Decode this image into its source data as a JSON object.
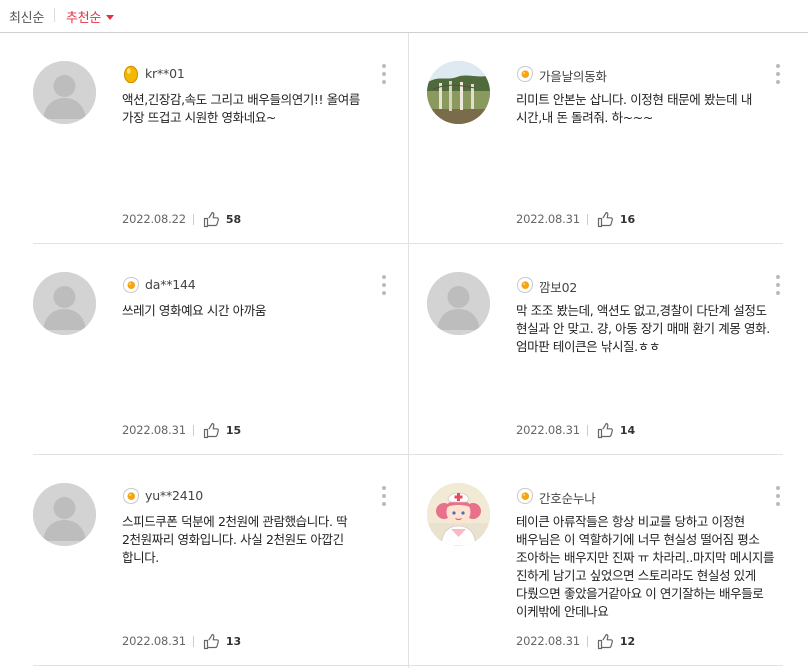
{
  "sort": {
    "latest_label": "최신순",
    "recommended_label": "추천순",
    "active_color": "#e33244"
  },
  "reviews": [
    {
      "username": "kr**01",
      "badge_icon": "gold-egg-icon",
      "avatar": "default-avatar",
      "text": "액션,긴장감,속도 그리고 배우들의연기!! 올여름 가장 뜨겁고 시원한 영화네요~",
      "date": "2022.08.22",
      "likes": "58"
    },
    {
      "username": "가을날의동화",
      "badge_icon": "fried-egg-icon",
      "avatar": "outdoor-photo-avatar",
      "text": "리미트 안본눈 삽니다. 이정현 태문에 봤는데 내 시간,내 돈 돌려줘. 하~~~",
      "date": "2022.08.31",
      "likes": "16"
    },
    {
      "username": "da**144",
      "badge_icon": "fried-egg-icon",
      "avatar": "default-avatar",
      "text": "쓰레기 영화예요 시간 아까움",
      "date": "2022.08.31",
      "likes": "15"
    },
    {
      "username": "깜보02",
      "badge_icon": "fried-egg-icon",
      "avatar": "default-avatar",
      "text": "막 조조 봤는데, 액션도 없고,경찰이 다단계 설정도 현실과 안 맞고. 걍, 아동 장기 매매 환기 계몽 영화. 엄마판 테이큰은 낚시질.ㅎㅎ",
      "date": "2022.08.31",
      "likes": "14"
    },
    {
      "username": "yu**2410",
      "badge_icon": "fried-egg-icon",
      "avatar": "default-avatar",
      "text": "스피드쿠폰 덕분에 2천원에 관람했습니다. 딱 2천원짜리 영화입니다. 사실 2천원도 아깝긴 합니다.",
      "date": "2022.08.31",
      "likes": "13"
    },
    {
      "username": "간호순누나",
      "badge_icon": "fried-egg-icon",
      "avatar": "nurse-character-avatar",
      "text": "테이큰 아류작들은 항상 비교를 당하고 이정현 배우님은 이 역할하기에 너무 현실성 떨어짐 평소 조아하는 배우지만 진짜 ㅠ 차라리..마지막 메시지를 진하게 남기고 싶었으면 스토리라도 현실성 있게 다뤘으면 좋았을거같아요 이 연기잘하는 배우들로 이케밖에 안데나요",
      "date": "2022.08.31",
      "likes": "12"
    }
  ]
}
